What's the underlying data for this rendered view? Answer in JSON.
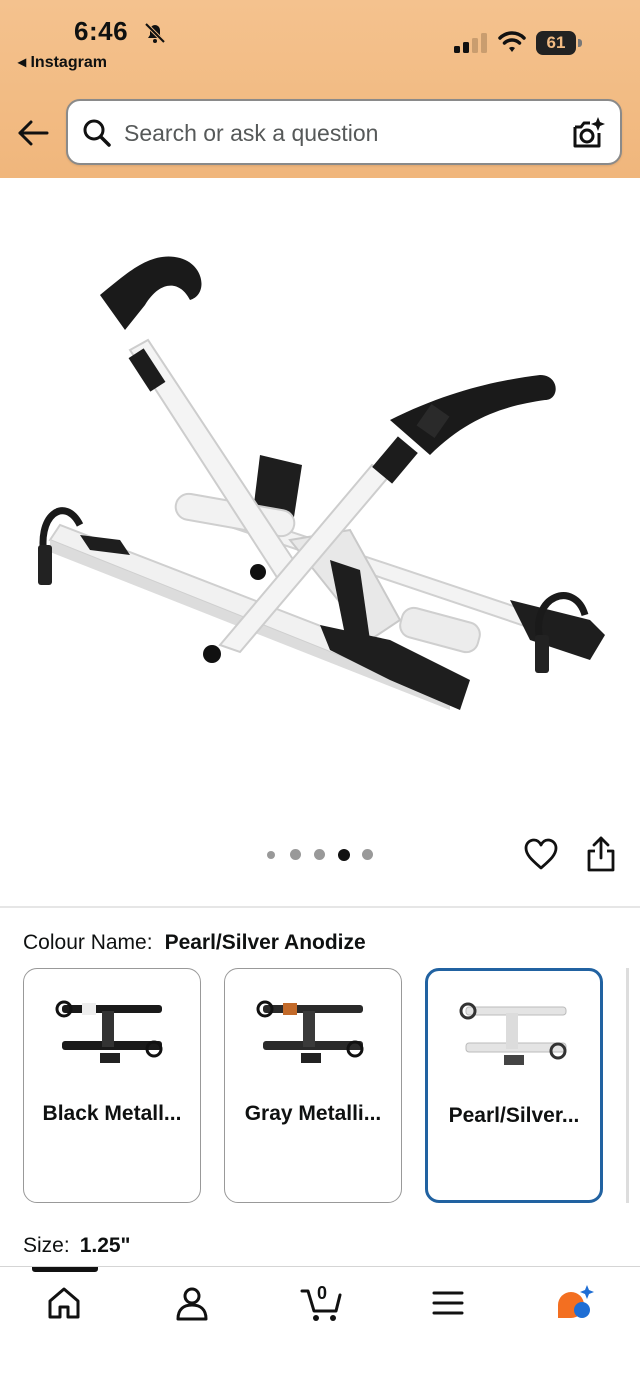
{
  "status_bar": {
    "time": "6:46",
    "back_app": "◂ Instagram",
    "battery": "61"
  },
  "search": {
    "placeholder": "Search or ask a question"
  },
  "gallery": {
    "image_count": 5,
    "active_index": 3
  },
  "colour": {
    "label": "Colour Name:",
    "value": "Pearl/Silver Anodize",
    "options": [
      {
        "name": "Black Metall..."
      },
      {
        "name": "Gray Metalli..."
      },
      {
        "name": "Pearl/Silver..."
      }
    ],
    "selected_index": 2
  },
  "size": {
    "label": "Size:",
    "value": "1.25\""
  },
  "tabbar": {
    "cart_count": "0",
    "items": [
      "home-icon",
      "account-icon",
      "cart-icon",
      "menu-icon",
      "rufus-icon"
    ]
  },
  "colors": {
    "header": "#f2bb83",
    "selected_border": "#2162a1"
  }
}
